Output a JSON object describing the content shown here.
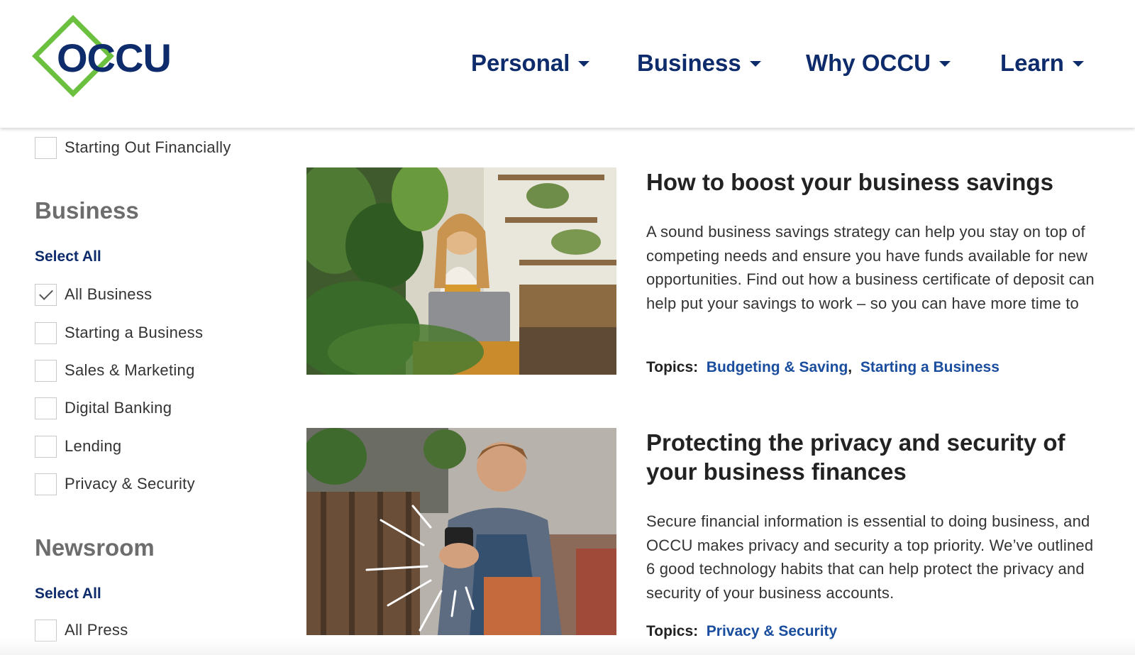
{
  "brand": {
    "logo_text": "OCCU",
    "primary_color": "#0e2c6b",
    "accent_color": "#6cc040",
    "link_color": "#1a4d9e"
  },
  "nav": {
    "items": [
      {
        "label": "Personal"
      },
      {
        "label": "Business"
      },
      {
        "label": "Why OCCU"
      },
      {
        "label": "Learn"
      }
    ]
  },
  "sidebar": {
    "personal_tail": [
      {
        "label": "Starting Out Financially",
        "checked": false
      }
    ],
    "business": {
      "title": "Business",
      "select_all": "Select All",
      "options": [
        {
          "label": "All Business",
          "checked": true
        },
        {
          "label": "Starting a Business",
          "checked": false
        },
        {
          "label": "Sales & Marketing",
          "checked": false
        },
        {
          "label": "Digital Banking",
          "checked": false
        },
        {
          "label": "Lending",
          "checked": false
        },
        {
          "label": "Privacy & Security",
          "checked": false
        }
      ]
    },
    "newsroom": {
      "title": "Newsroom",
      "select_all": "Select All",
      "options": [
        {
          "label": "All Press",
          "checked": false
        }
      ]
    }
  },
  "articles": [
    {
      "title": "How to boost your business savings",
      "body": "A sound business savings strategy can help you stay on top of competing needs and ensure you have funds available for new opportunities. Find out how a business certificate of deposit can help put your savings to work – so you can have more time to",
      "topics_label": "Topics:",
      "topics": [
        "Budgeting & Saving",
        "Starting a Business"
      ],
      "image": "woman-with-laptop-among-plants"
    },
    {
      "title": "Protecting the privacy and security of your business finances",
      "body": "Secure financial information is essential to doing business, and OCCU makes privacy and security a top priority. We’ve outlined 6 good technology habits that can help protect the privacy and security of your business accounts.",
      "topics_label": "Topics:",
      "topics": [
        "Privacy & Security"
      ],
      "image": "man-in-apron-using-phone"
    }
  ]
}
